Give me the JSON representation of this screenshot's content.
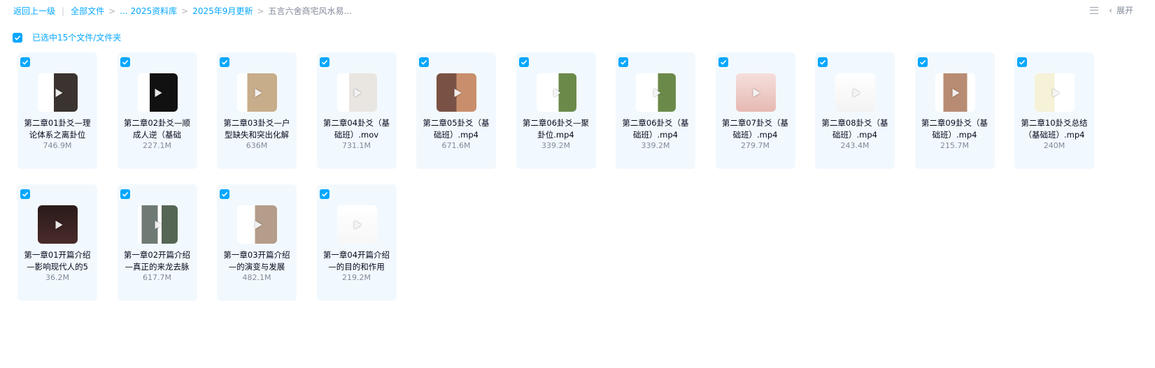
{
  "breadcrumb": {
    "back": "返回上一级",
    "all_files": "全部文件",
    "ellipsis": "...",
    "path": [
      "2025资料库",
      "2025年9月更新"
    ],
    "current": "五言六舍商宅风水易..."
  },
  "toolbar": {
    "expand_label": "展开"
  },
  "selection": {
    "label": "已选中15个文件/文件夹"
  },
  "colors": {
    "accent": "#06a7ff",
    "card_bg": "#f2f9fe",
    "muted": "#818999"
  },
  "files": [
    {
      "name": "第二章01卦爻—理论体系之离卦位",
      "size": "746.9M",
      "icon": "video-thumbnail-icon"
    },
    {
      "name": "第二章02卦爻—顺成人逆（基础",
      "size": "227.1M",
      "icon": "video-thumbnail-icon"
    },
    {
      "name": "第二章03卦爻—户型缺失和突出化解",
      "size": "636M",
      "icon": "video-thumbnail-icon"
    },
    {
      "name": "第二章04卦爻（基础班）.mov",
      "size": "731.1M",
      "icon": "video-thumbnail-icon"
    },
    {
      "name": "第二章05卦爻（基础班）.mp4",
      "size": "671.6M",
      "icon": "video-thumbnail-icon"
    },
    {
      "name": "第二章06卦爻—聚卦位.mp4",
      "size": "339.2M",
      "icon": "video-thumbnail-icon"
    },
    {
      "name": "第二章06卦爻（基础班）.mp4",
      "size": "339.2M",
      "icon": "video-thumbnail-icon"
    },
    {
      "name": "第二章07卦爻（基础班）.mp4",
      "size": "279.7M",
      "icon": "video-thumbnail-icon"
    },
    {
      "name": "第二章08卦爻（基础班）.mp4",
      "size": "243.4M",
      "icon": "video-thumbnail-icon"
    },
    {
      "name": "第二章09卦爻（基础班）.mp4",
      "size": "215.7M",
      "icon": "video-thumbnail-icon"
    },
    {
      "name": "第二章10卦爻总结（基础班）.mp4",
      "size": "240M",
      "icon": "video-thumbnail-icon"
    },
    {
      "name": "第一章01开篇介绍—影响现代人的5",
      "size": "36.2M",
      "icon": "video-thumbnail-icon"
    },
    {
      "name": "第一章02开篇介绍—真正的来龙去脉",
      "size": "617.7M",
      "icon": "video-thumbnail-icon"
    },
    {
      "name": "第一章03开篇介绍—的演变与发展",
      "size": "482.1M",
      "icon": "video-thumbnail-icon"
    },
    {
      "name": "第一章04开篇介绍—的目的和作用",
      "size": "219.2M",
      "icon": "video-thumbnail-icon"
    }
  ]
}
